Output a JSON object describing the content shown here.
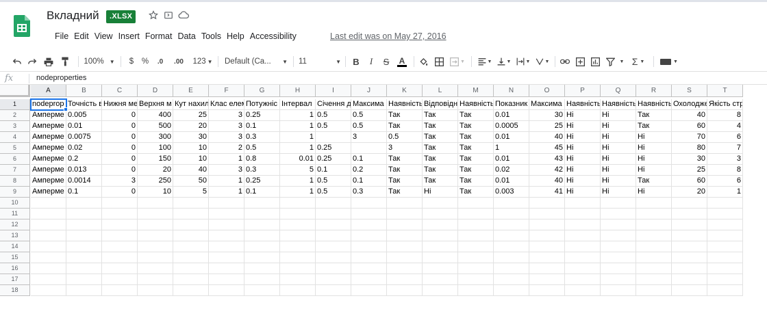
{
  "header": {
    "title": "Вкладний",
    "badge": ".XLSX",
    "last_edit": "Last edit was on May 27, 2016",
    "icons": [
      "star-icon",
      "move-to-folder-icon",
      "cloud-status-icon"
    ]
  },
  "menu": [
    "File",
    "Edit",
    "View",
    "Insert",
    "Format",
    "Data",
    "Tools",
    "Help",
    "Accessibility"
  ],
  "toolbar": {
    "zoom": "100%",
    "currency": "$",
    "percent": "%",
    "dec_decrease": ".0",
    "dec_increase": ".00",
    "more_formats": "123",
    "font": "Default (Ca...",
    "font_size": "11",
    "bold": "B",
    "italic": "I",
    "strike": "S",
    "text_color": "A",
    "sum": "Σ",
    "icons": [
      "undo-icon",
      "redo-icon",
      "print-icon",
      "paint-format-icon",
      "fill-color-icon",
      "borders-icon",
      "merge-cells-icon",
      "align-left-icon",
      "valign-bottom-icon",
      "text-wrap-icon",
      "text-rotate-icon",
      "link-icon",
      "insert-comment-icon",
      "insert-chart-icon",
      "filter-icon",
      "functions-icon",
      "input-tools-icon"
    ]
  },
  "formula_bar": {
    "fx": "fx",
    "value": "nodeproperties"
  },
  "columns": [
    "A",
    "B",
    "C",
    "D",
    "E",
    "F",
    "G",
    "H",
    "I",
    "J",
    "K",
    "L",
    "M",
    "N",
    "O",
    "P",
    "Q",
    "R",
    "S",
    "T"
  ],
  "row_numbers": [
    "1",
    "2",
    "3",
    "4",
    "5",
    "6",
    "7",
    "8",
    "9",
    "10",
    "11",
    "12",
    "13",
    "14",
    "15",
    "16",
    "17",
    "18"
  ],
  "rows": [
    [
      "nodeprop",
      "Точність в",
      "Нижня ме",
      "Верхня м",
      "Кут нахил",
      "Клас елем",
      "Потужніс",
      "Інтервал",
      "Січення д",
      "Максима",
      "Наявність",
      "Відповідн",
      "Наявність",
      "Показник",
      "Максима",
      "Наявність",
      "Наявність",
      "Наявність",
      "Охолоджен",
      "Якість стр"
    ],
    [
      "Амперме",
      "0.005",
      "0",
      "400",
      "25",
      "3",
      "0.25",
      "1",
      "0.5",
      "0.5",
      "Так",
      "Так",
      "Так",
      "0.01",
      "30",
      "Ні",
      "Ні",
      "Так",
      "40",
      "8"
    ],
    [
      "Амперме",
      "0.01",
      "0",
      "500",
      "20",
      "3",
      "0.1",
      "1",
      "0.5",
      "0.5",
      "Так",
      "Так",
      "Так",
      "0.0005",
      "25",
      "Ні",
      "Ні",
      "Так",
      "60",
      "4"
    ],
    [
      "Амперме",
      "0.0075",
      "0",
      "300",
      "30",
      "3",
      "0.3",
      "1",
      "",
      "3",
      "0.5",
      "Так",
      "Так",
      "0.01",
      "40",
      "Ні",
      "Ні",
      "Ні",
      "70",
      "6"
    ],
    [
      "Амперме",
      "0.02",
      "0",
      "100",
      "10",
      "2",
      "0.5",
      "1",
      "0.25",
      "",
      "3",
      "Так",
      "Так",
      "1",
      "45",
      "Ні",
      "Ні",
      "Ні",
      "80",
      "7"
    ],
    [
      "Амперме",
      "0.2",
      "0",
      "150",
      "10",
      "1",
      "0.8",
      "0.01",
      "0.25",
      "0.1",
      "Так",
      "Так",
      "Так",
      "0.01",
      "43",
      "Ні",
      "Ні",
      "Ні",
      "30",
      "3"
    ],
    [
      "Амперме",
      "0.013",
      "0",
      "20",
      "40",
      "3",
      "0.3",
      "5",
      "0.1",
      "0.2",
      "Так",
      "Так",
      "Так",
      "0.02",
      "42",
      "Ні",
      "Ні",
      "Ні",
      "25",
      "8"
    ],
    [
      "Амперме",
      "0.0014",
      "3",
      "250",
      "50",
      "1",
      "0.25",
      "1",
      "0.5",
      "0.1",
      "Так",
      "Так",
      "Так",
      "0.01",
      "40",
      "Ні",
      "Ні",
      "Так",
      "60",
      "6"
    ],
    [
      "Амперме",
      "0.1",
      "0",
      "10",
      "5",
      "1",
      "0.1",
      "1",
      "0.5",
      "0.3",
      "Так",
      "Ні",
      "Так",
      "0.003",
      "41",
      "Ні",
      "Ні",
      "Ні",
      "20",
      "1"
    ]
  ]
}
